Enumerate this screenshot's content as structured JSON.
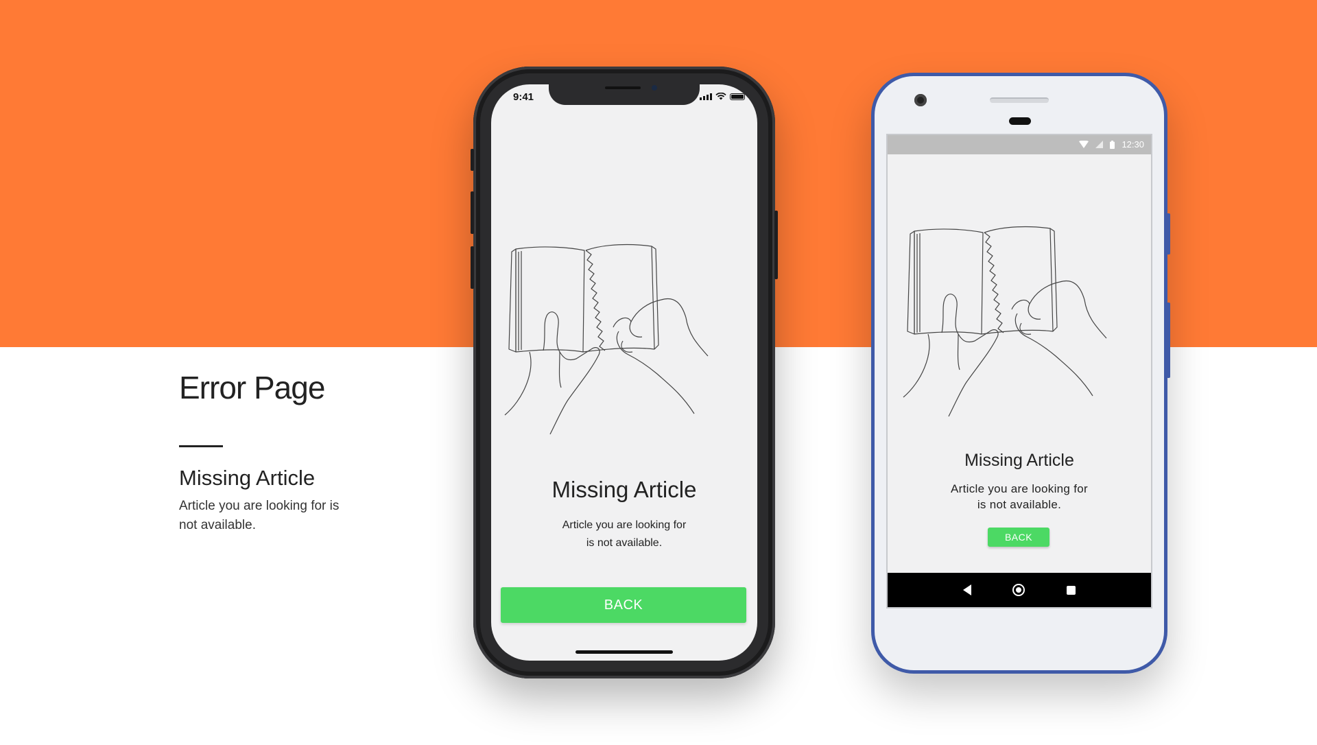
{
  "left": {
    "title": "Error Page",
    "subtitle": "Missing Article",
    "desc": "Article you are looking for is not available."
  },
  "iphone": {
    "status_time": "9:41",
    "title": "Missing Article",
    "desc_line1": "Article you are looking for",
    "desc_line2": "is not available.",
    "button": "BACK"
  },
  "android": {
    "status_time": "12:30",
    "title": "Missing Article",
    "desc_line1": "Article you are looking for",
    "desc_line2": "is not available.",
    "button": "BACK"
  },
  "colors": {
    "accent_orange": "#FF7A35",
    "button_green": "#4CD964",
    "android_frame": "#3F5AA8"
  },
  "icons": [
    "signal-icon",
    "wifi-icon",
    "battery-icon",
    "nav-back-icon",
    "nav-home-icon",
    "nav-recents-icon",
    "book-hands-illustration"
  ]
}
